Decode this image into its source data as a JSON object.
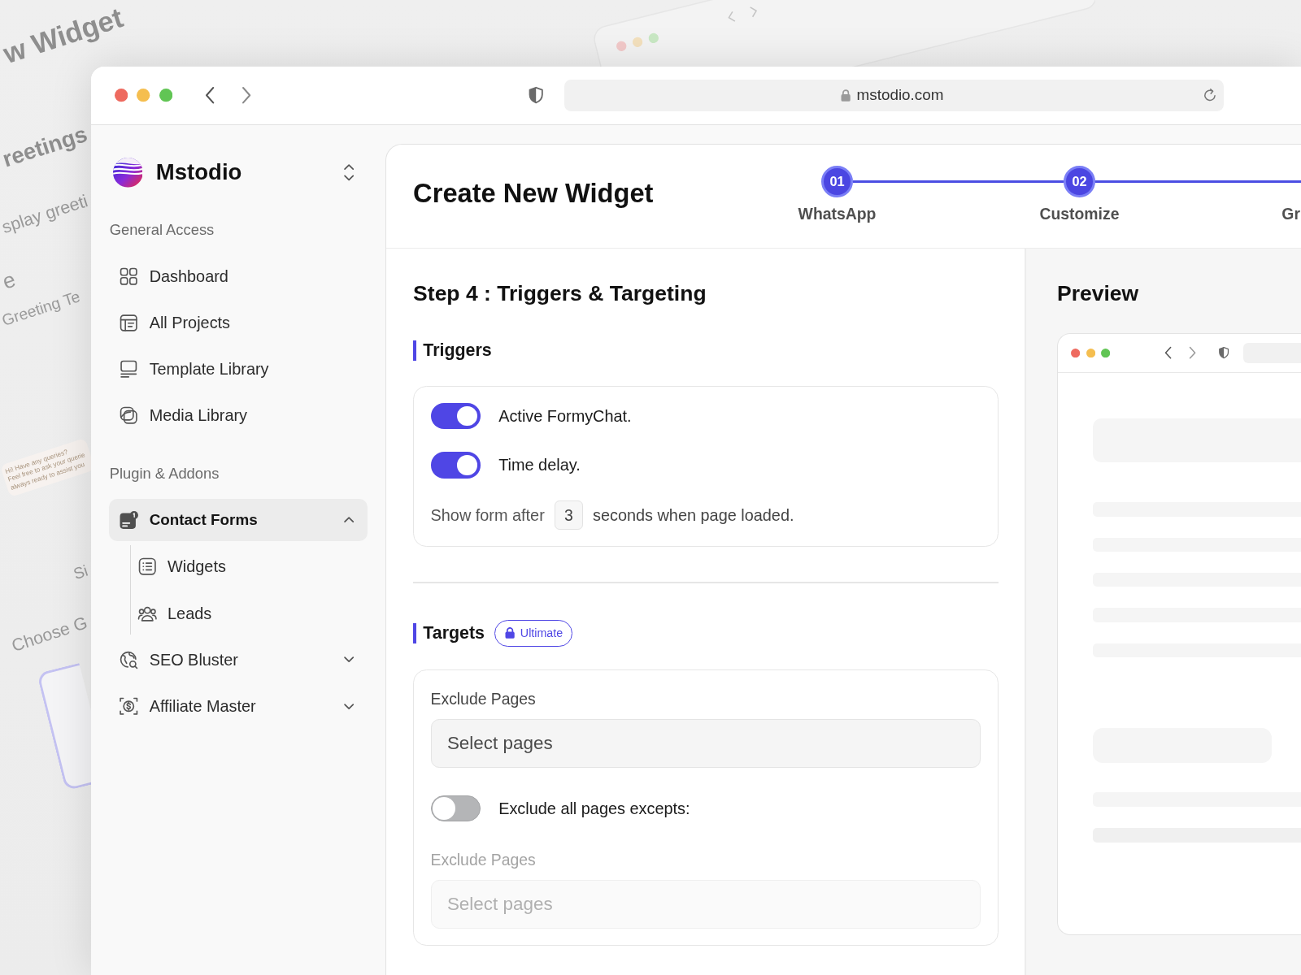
{
  "backdrop": {
    "heading": "w Widget",
    "section_title": "reetings",
    "description": "splay greeti",
    "field_label": "e",
    "field_value": "Greeting Te",
    "chat_lines": [
      "Hi! Have any queries?",
      "Feel free to ask your querie",
      "always ready to assist you"
    ],
    "option_label": "Si",
    "choice_title": "Choose G"
  },
  "window": {
    "url": "mstodio.com"
  },
  "sidebar": {
    "brand": "Mstodio",
    "sections": [
      {
        "title": "General Access",
        "items": [
          {
            "label": "Dashboard",
            "selected": false
          },
          {
            "label": "All Projects",
            "selected": false
          },
          {
            "label": "Template Library",
            "selected": false
          },
          {
            "label": "Media Library",
            "selected": false
          }
        ]
      },
      {
        "title": "Plugin & Addons",
        "items": [
          {
            "label": "Contact Forms",
            "selected": true,
            "expanded": true,
            "children": [
              {
                "label": "Widgets",
                "selected": false
              },
              {
                "label": "Leads",
                "selected": false
              }
            ]
          },
          {
            "label": "SEO Bluster",
            "selected": false,
            "expanded": false
          },
          {
            "label": "Affiliate Master",
            "selected": false,
            "expanded": false
          }
        ]
      }
    ]
  },
  "page": {
    "title": "Create New Widget",
    "steps": [
      {
        "number": "01",
        "label": "WhatsApp"
      },
      {
        "number": "02",
        "label": "Customize"
      },
      {
        "label": "Gr"
      }
    ]
  },
  "form": {
    "title": "Step 4 : Triggers & Targeting",
    "triggers": {
      "heading": "Triggers",
      "items": [
        {
          "kind": "toggle",
          "label": "Active FormyChat.",
          "on": true
        },
        {
          "kind": "toggle",
          "label": "Time delay.",
          "on": true
        },
        {
          "kind": "delay",
          "before": "Show form after",
          "value": "3",
          "after": "seconds when page loaded."
        }
      ]
    },
    "targets": {
      "heading": "Targets",
      "badge": "Ultimate",
      "items": [
        {
          "kind": "select",
          "label": "Exclude Pages",
          "placeholder": "Select pages",
          "disabled": false
        },
        {
          "kind": "toggle",
          "label": "Exclude all pages excepts:",
          "on": false
        },
        {
          "kind": "select",
          "label": "Exclude Pages",
          "placeholder": "Select pages",
          "disabled": true
        }
      ]
    }
  },
  "preview": {
    "title": "Preview"
  }
}
